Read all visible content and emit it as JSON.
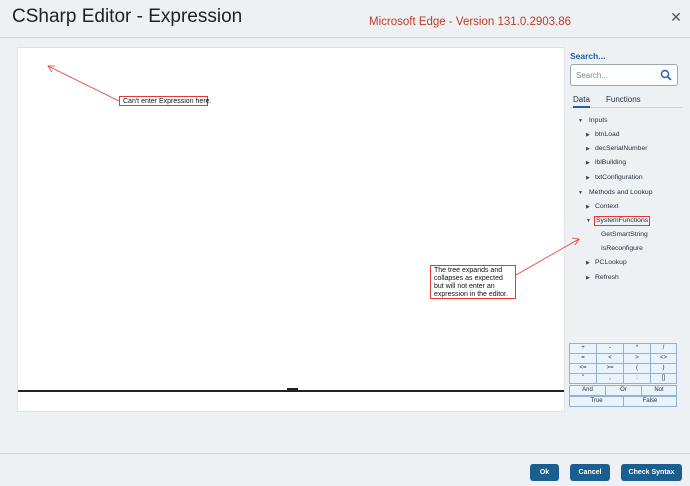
{
  "dialog": {
    "title": "CSharp Editor - Expression",
    "banner": "Microsoft Edge - Version 131.0.2903.86",
    "close_glyph": "✕"
  },
  "annotations": {
    "callout_1": "Can't enter Expression here.",
    "callout_2": "The tree expands and collapses as expected but will not enter an expression in the editor."
  },
  "sidebar": {
    "search_label": "Search...",
    "search_placeholder": "Search...",
    "tabs": [
      {
        "label": "Data",
        "active": true
      },
      {
        "label": "Functions",
        "active": false
      }
    ],
    "tree": {
      "inputs": {
        "label": "Inputs",
        "expanded": true,
        "children": [
          "btnLoad",
          "decSerialNumber",
          "lblBuilding",
          "txtConfiguration"
        ]
      },
      "methods": {
        "label": "Methods and Lookup",
        "expanded": true,
        "context": "Context",
        "system_functions": {
          "label": "SystemFunctions",
          "expanded": true,
          "children": [
            "GetSmartString",
            "IsReconfigure"
          ]
        },
        "pclookup": "PCLookup",
        "refresh": "Refresh"
      }
    }
  },
  "operators": [
    [
      "+",
      "-",
      "*",
      "/"
    ],
    [
      "=",
      "<",
      ">",
      "<>"
    ],
    [
      "<=",
      ">=",
      "(",
      ")"
    ],
    [
      "\"",
      ",",
      ":",
      "[]"
    ],
    [
      "And",
      "Or",
      "Not"
    ],
    [
      "True",
      "False"
    ]
  ],
  "footer": {
    "ok_label": "Ok",
    "cancel_label": "Cancel",
    "check_label": "Check Syntax"
  },
  "colors": {
    "primary_button": "#1a5f8f",
    "banner_text": "#c0392b",
    "annotation_red": "#e53935",
    "operator_fill": "#eaf2fa"
  }
}
